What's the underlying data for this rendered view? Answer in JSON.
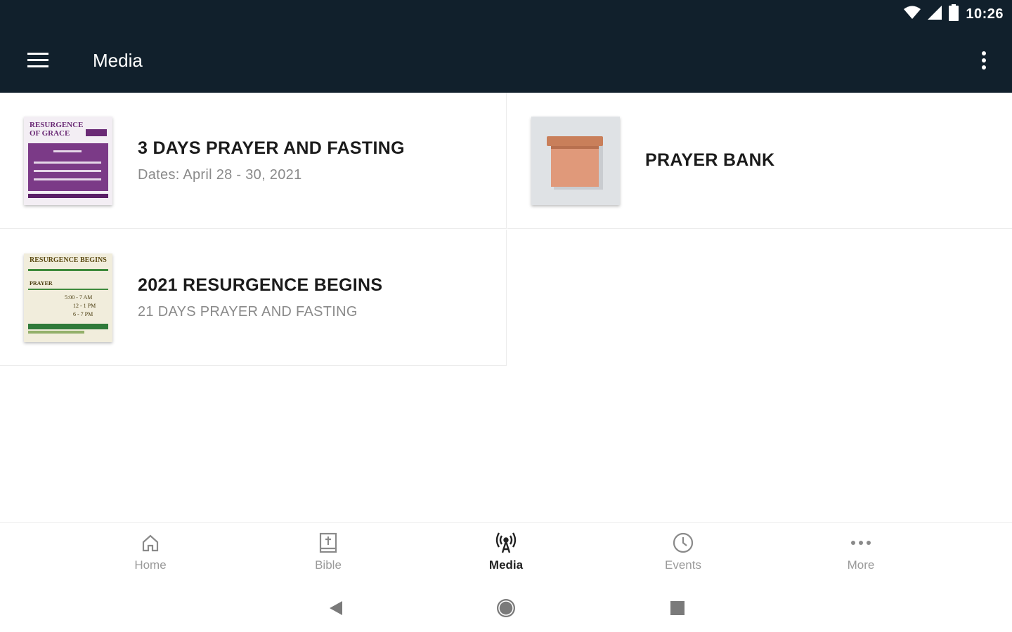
{
  "status": {
    "time": "10:26"
  },
  "toolbar": {
    "title": "Media"
  },
  "cards": [
    {
      "title": "3 DAYS PRAYER AND FASTING",
      "subtitle": "Dates: April 28 - 30, 2021"
    },
    {
      "title": "PRAYER BANK",
      "subtitle": ""
    },
    {
      "title": "2021 RESURGENCE BEGINS",
      "subtitle": "21 DAYS PRAYER AND FASTING"
    }
  ],
  "thumbs": {
    "t1": {
      "line1": "RESURGENCE",
      "line2": "OF GRACE"
    },
    "t3": {
      "head": "RESURGENCE BEGINS",
      "label": "PRAYER",
      "time1": "5:00 - 7 AM",
      "time2": "12 - 1 PM",
      "time3": "6 - 7 PM"
    }
  },
  "bottom_nav": [
    {
      "label": "Home",
      "icon": "home-icon"
    },
    {
      "label": "Bible",
      "icon": "bible-icon"
    },
    {
      "label": "Media",
      "icon": "broadcast-icon",
      "active": true
    },
    {
      "label": "Events",
      "icon": "clock-icon"
    },
    {
      "label": "More",
      "icon": "more-horizontal-icon"
    }
  ],
  "colors": {
    "appbar": "#11202c",
    "active_label": "#222222",
    "inactive_label": "#9a9a9a"
  }
}
